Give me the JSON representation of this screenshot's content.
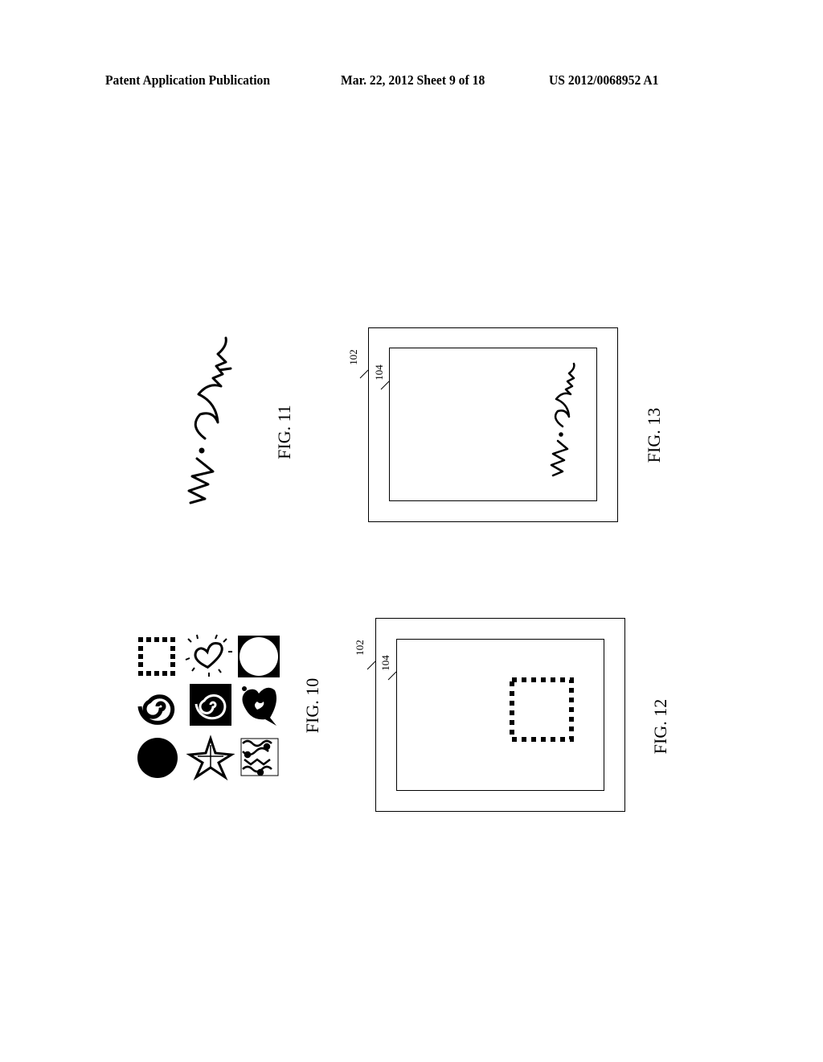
{
  "header": {
    "publication": "Patent Application Publication",
    "date_sheet": "Mar. 22, 2012  Sheet 9 of 18",
    "patent_number": "US 2012/0068952 A1"
  },
  "figures": {
    "fig10": {
      "label": "FIG. 10",
      "icons": [
        "dotted-square-icon",
        "radiating-heart-icon",
        "circle-in-square-icon",
        "spiral-icon",
        "spiral-in-square-icon",
        "leaf-heart-icon",
        "filled-circle-icon",
        "star-icon",
        "pattern-square-icon"
      ]
    },
    "fig11": {
      "label": "FIG. 11",
      "signature": "M. Smith"
    },
    "fig12": {
      "label": "FIG. 12",
      "ref_outer": "102",
      "ref_inner": "104"
    },
    "fig13": {
      "label": "FIG. 13",
      "ref_outer": "102",
      "ref_inner": "104",
      "signature": "M. Smith"
    }
  }
}
